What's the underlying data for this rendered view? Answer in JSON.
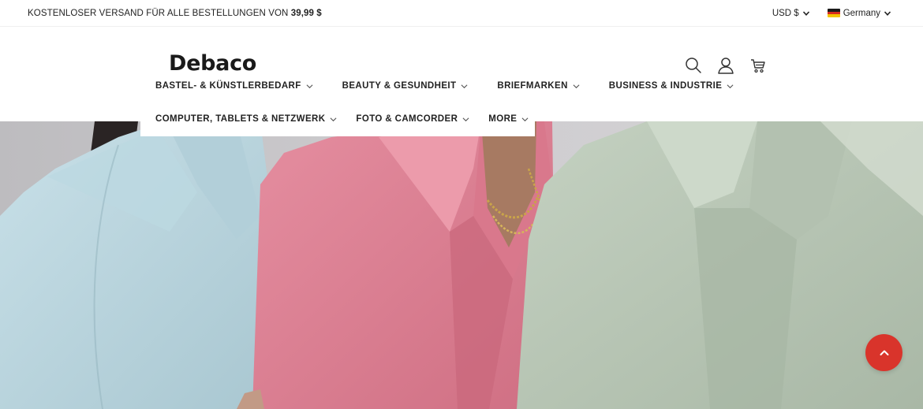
{
  "topbar": {
    "announcement_prefix": "KOSTENLOSER VERSAND FÜR ALLE BESTELLUNGEN VON ",
    "announcement_amount": "39,99 $",
    "currency": "USD $",
    "country": "Germany"
  },
  "header": {
    "logo": "Debaco",
    "icons": [
      "search-icon",
      "user-icon",
      "cart-icon"
    ]
  },
  "nav": {
    "row1": [
      {
        "label": "BASTEL- & KÜNSTLERBEDARF"
      },
      {
        "label": "BEAUTY & GESUNDHEIT"
      },
      {
        "label": "BRIEFMARKEN"
      },
      {
        "label": "BUSINESS & INDUSTRIE"
      }
    ],
    "row2": [
      {
        "label": "COMPUTER, TABLETS & NETZWERK"
      },
      {
        "label": "FOTO & CAMCORDER"
      },
      {
        "label": "MORE"
      }
    ]
  },
  "hero": {
    "image": "three-women-in-pastel-blazers",
    "colors": {
      "blue_blazer": "#b9d6df",
      "pink_blazer": "#de8194",
      "sage_blazer": "#b8c6b5",
      "background": "#c8c7c9"
    }
  },
  "back_to_top": {
    "icon": "chevron-up-icon",
    "color": "#d9342b"
  }
}
